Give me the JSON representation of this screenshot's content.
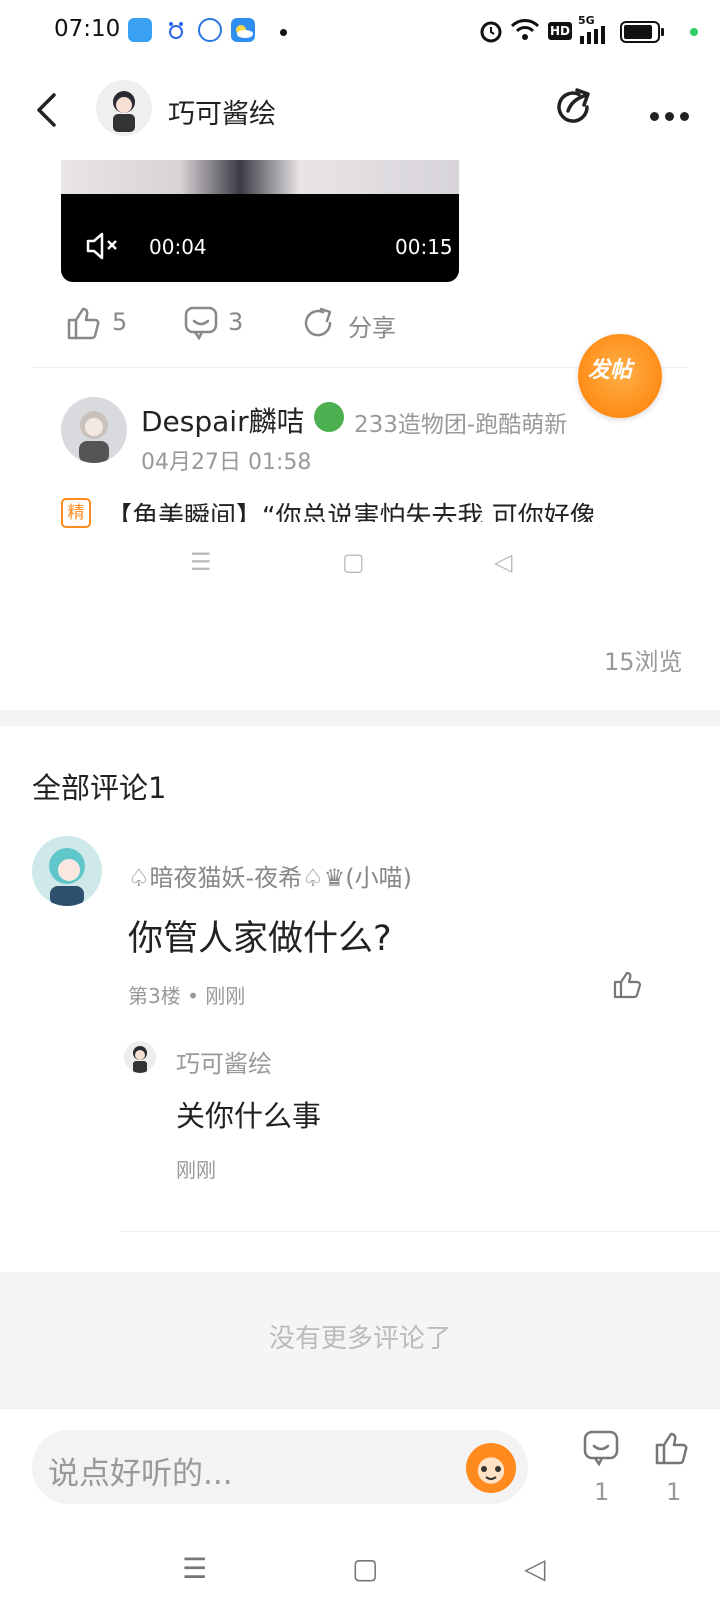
{
  "status_bar": {
    "time": "07:10",
    "app_icons": [
      "tp-link-icon",
      "baidu-icon",
      "ifly-icon",
      "weather-icon"
    ],
    "signal": "5G",
    "hd": "HD"
  },
  "header": {
    "title": "巧可酱绘",
    "back_icon": "back-arrow-icon",
    "share_icon": "share-icon",
    "more_icon": "more-icon"
  },
  "video": {
    "current_time": "00:04",
    "duration": "00:15",
    "mute_icon": "mute-icon"
  },
  "post_actions": {
    "likes": "5",
    "comments": "3",
    "share_label": "分享"
  },
  "fab": {
    "label": "发帖"
  },
  "embedded_post": {
    "author": "Despair麟咭",
    "group": "233造物团-跑酷萌新",
    "date": "04月27日 01:58",
    "badge": "精",
    "title": "【角美瞬间】“你总说害怕失去我 可你好像"
  },
  "views": "15浏览",
  "comments_header": "全部评论1",
  "comment": {
    "author": "♤暗夜猫妖-夜希♤♛(小喵)",
    "text": "你管人家做什么?",
    "meta": "第3楼 • 刚刚",
    "reply": {
      "author": "巧可酱绘",
      "text": "关你什么事",
      "time": "刚刚"
    }
  },
  "no_more": "没有更多评论了",
  "bottom_bar": {
    "placeholder": "说点好听的...",
    "comment_count": "1",
    "like_count": "1"
  },
  "colors": {
    "accent": "#ff7d00",
    "text": "#222222",
    "muted": "#999999"
  }
}
